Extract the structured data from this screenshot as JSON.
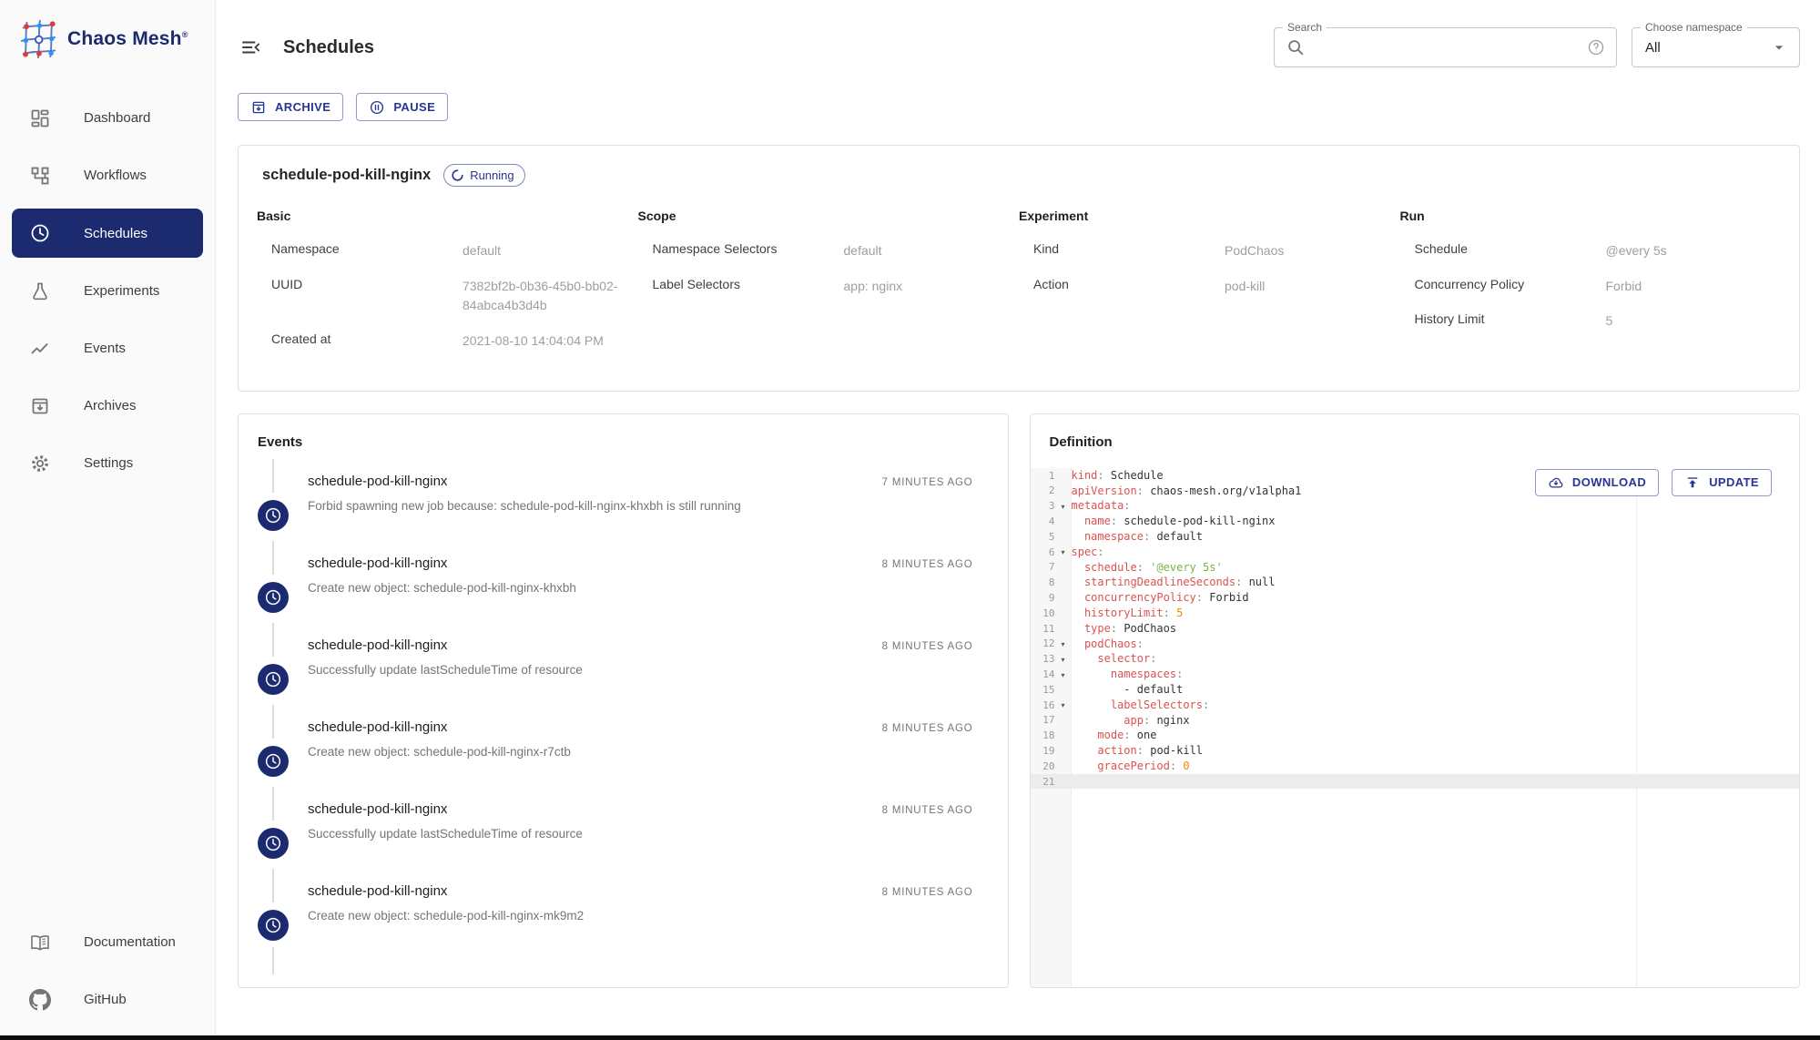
{
  "colors": {
    "accent": "#283593",
    "navy": "#1c2b70",
    "sidebar-bg": "#fafafa",
    "border": "#e0e0e0",
    "text-primary": "#212121",
    "text-secondary": "#757575",
    "value-gray": "#9e9e9e",
    "code-key": "#d9534f",
    "code-string": "#7cb342",
    "code-number": "#ef8c00",
    "gutter-bg": "#f7f7f7",
    "active-line": "#ececec"
  },
  "brand": {
    "name": "Chaos Mesh",
    "registered": "®"
  },
  "sidebar": {
    "items": [
      {
        "label": "Dashboard",
        "icon": "dashboard-icon"
      },
      {
        "label": "Workflows",
        "icon": "workflow-icon"
      },
      {
        "label": "Schedules",
        "icon": "clock-icon",
        "selected": true
      },
      {
        "label": "Experiments",
        "icon": "flask-icon"
      },
      {
        "label": "Events",
        "icon": "trend-icon"
      },
      {
        "label": "Archives",
        "icon": "archive-icon"
      },
      {
        "label": "Settings",
        "icon": "gear-icon"
      }
    ],
    "footer_items": [
      {
        "label": "Documentation",
        "icon": "book-icon"
      },
      {
        "label": "GitHub",
        "icon": "github-icon"
      }
    ]
  },
  "header": {
    "title": "Schedules",
    "search_label": "Search",
    "search_value": "",
    "namespace_label": "Choose namespace",
    "namespace_value": "All"
  },
  "toolbar": {
    "archive_label": "ARCHIVE",
    "pause_label": "PAUSE"
  },
  "schedule": {
    "name": "schedule-pod-kill-nginx",
    "status": "Running",
    "sections": [
      {
        "title": "Basic",
        "rows": [
          {
            "label": "Namespace",
            "value": "default"
          },
          {
            "label": "UUID",
            "value": "7382bf2b-0b36-45b0-bb02-84abca4b3d4b"
          },
          {
            "label": "Created at",
            "value": "2021-08-10 14:04:04 PM"
          }
        ]
      },
      {
        "title": "Scope",
        "rows": [
          {
            "label": "Namespace Selectors",
            "value": "default"
          },
          {
            "label": "Label Selectors",
            "value": "app: nginx"
          }
        ]
      },
      {
        "title": "Experiment",
        "rows": [
          {
            "label": "Kind",
            "value": "PodChaos"
          },
          {
            "label": "Action",
            "value": "pod-kill"
          }
        ]
      },
      {
        "title": "Run",
        "rows": [
          {
            "label": "Schedule",
            "value": "@every 5s"
          },
          {
            "label": "Concurrency Policy",
            "value": "Forbid"
          },
          {
            "label": "History Limit",
            "value": "5"
          }
        ]
      }
    ]
  },
  "events_panel": {
    "title": "Events",
    "items": [
      {
        "name": "schedule-pod-kill-nginx",
        "message": "Forbid spawning new job because: schedule-pod-kill-nginx-khxbh is still running",
        "time": "7 MINUTES AGO"
      },
      {
        "name": "schedule-pod-kill-nginx",
        "message": "Create new object: schedule-pod-kill-nginx-khxbh",
        "time": "8 MINUTES AGO"
      },
      {
        "name": "schedule-pod-kill-nginx",
        "message": "Successfully update lastScheduleTime of resource",
        "time": "8 MINUTES AGO"
      },
      {
        "name": "schedule-pod-kill-nginx",
        "message": "Create new object: schedule-pod-kill-nginx-r7ctb",
        "time": "8 MINUTES AGO"
      },
      {
        "name": "schedule-pod-kill-nginx",
        "message": "Successfully update lastScheduleTime of resource",
        "time": "8 MINUTES AGO"
      },
      {
        "name": "schedule-pod-kill-nginx",
        "message": "Create new object: schedule-pod-kill-nginx-mk9m2",
        "time": "8 MINUTES AGO"
      }
    ]
  },
  "definition_panel": {
    "title": "Definition",
    "download_label": "DOWNLOAD",
    "update_label": "UPDATE",
    "code_lines": [
      {
        "num": 1,
        "fold": false,
        "tokens": [
          [
            "key",
            "kind"
          ],
          [
            "punc",
            ": "
          ],
          [
            "plain",
            "Schedule"
          ]
        ]
      },
      {
        "num": 2,
        "fold": false,
        "tokens": [
          [
            "key",
            "apiVersion"
          ],
          [
            "punc",
            ": "
          ],
          [
            "plain",
            "chaos-mesh.org/v1alpha1"
          ]
        ]
      },
      {
        "num": 3,
        "fold": true,
        "tokens": [
          [
            "key",
            "metadata"
          ],
          [
            "punc",
            ":"
          ]
        ]
      },
      {
        "num": 4,
        "fold": false,
        "tokens": [
          [
            "plain",
            "  "
          ],
          [
            "key",
            "name"
          ],
          [
            "punc",
            ": "
          ],
          [
            "plain",
            "schedule-pod-kill-nginx"
          ]
        ]
      },
      {
        "num": 5,
        "fold": false,
        "tokens": [
          [
            "plain",
            "  "
          ],
          [
            "key",
            "namespace"
          ],
          [
            "punc",
            ": "
          ],
          [
            "plain",
            "default"
          ]
        ]
      },
      {
        "num": 6,
        "fold": true,
        "tokens": [
          [
            "key",
            "spec"
          ],
          [
            "punc",
            ":"
          ]
        ]
      },
      {
        "num": 7,
        "fold": false,
        "tokens": [
          [
            "plain",
            "  "
          ],
          [
            "key",
            "schedule"
          ],
          [
            "punc",
            ": "
          ],
          [
            "str",
            "'@every 5s'"
          ]
        ]
      },
      {
        "num": 8,
        "fold": false,
        "tokens": [
          [
            "plain",
            "  "
          ],
          [
            "key",
            "startingDeadlineSeconds"
          ],
          [
            "punc",
            ": "
          ],
          [
            "plain",
            "null"
          ]
        ]
      },
      {
        "num": 9,
        "fold": false,
        "tokens": [
          [
            "plain",
            "  "
          ],
          [
            "key",
            "concurrencyPolicy"
          ],
          [
            "punc",
            ": "
          ],
          [
            "plain",
            "Forbid"
          ]
        ]
      },
      {
        "num": 10,
        "fold": false,
        "tokens": [
          [
            "plain",
            "  "
          ],
          [
            "key",
            "historyLimit"
          ],
          [
            "punc",
            ": "
          ],
          [
            "num",
            "5"
          ]
        ]
      },
      {
        "num": 11,
        "fold": false,
        "tokens": [
          [
            "plain",
            "  "
          ],
          [
            "key",
            "type"
          ],
          [
            "punc",
            ": "
          ],
          [
            "plain",
            "PodChaos"
          ]
        ]
      },
      {
        "num": 12,
        "fold": true,
        "tokens": [
          [
            "plain",
            "  "
          ],
          [
            "key",
            "podChaos"
          ],
          [
            "punc",
            ":"
          ]
        ]
      },
      {
        "num": 13,
        "fold": true,
        "tokens": [
          [
            "plain",
            "    "
          ],
          [
            "key",
            "selector"
          ],
          [
            "punc",
            ":"
          ]
        ]
      },
      {
        "num": 14,
        "fold": true,
        "tokens": [
          [
            "plain",
            "      "
          ],
          [
            "key",
            "namespaces"
          ],
          [
            "punc",
            ":"
          ]
        ]
      },
      {
        "num": 15,
        "fold": false,
        "tokens": [
          [
            "plain",
            "        - default"
          ]
        ]
      },
      {
        "num": 16,
        "fold": true,
        "tokens": [
          [
            "plain",
            "      "
          ],
          [
            "key",
            "labelSelectors"
          ],
          [
            "punc",
            ":"
          ]
        ]
      },
      {
        "num": 17,
        "fold": false,
        "tokens": [
          [
            "plain",
            "        "
          ],
          [
            "key",
            "app"
          ],
          [
            "punc",
            ": "
          ],
          [
            "plain",
            "nginx"
          ]
        ]
      },
      {
        "num": 18,
        "fold": false,
        "tokens": [
          [
            "plain",
            "    "
          ],
          [
            "key",
            "mode"
          ],
          [
            "punc",
            ": "
          ],
          [
            "plain",
            "one"
          ]
        ]
      },
      {
        "num": 19,
        "fold": false,
        "tokens": [
          [
            "plain",
            "    "
          ],
          [
            "key",
            "action"
          ],
          [
            "punc",
            ": "
          ],
          [
            "plain",
            "pod-kill"
          ]
        ]
      },
      {
        "num": 20,
        "fold": false,
        "tokens": [
          [
            "plain",
            "    "
          ],
          [
            "key",
            "gracePeriod"
          ],
          [
            "punc",
            ": "
          ],
          [
            "num",
            "0"
          ]
        ]
      },
      {
        "num": 21,
        "fold": false,
        "active": true,
        "tokens": []
      }
    ]
  }
}
